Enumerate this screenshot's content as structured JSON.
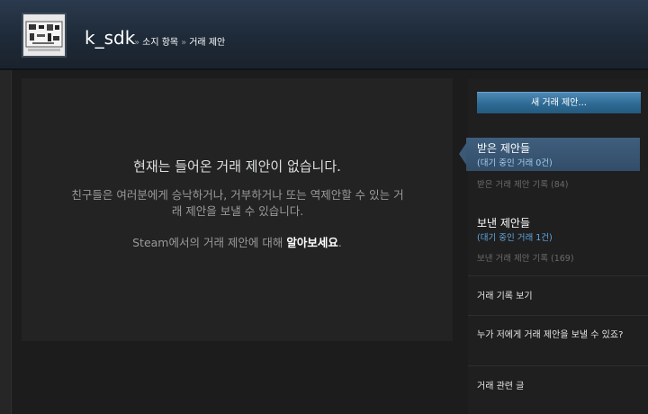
{
  "header": {
    "username": "k_sdk",
    "breadcrumb": [
      {
        "label": "소지 항목"
      },
      {
        "label": "거래 제안"
      }
    ],
    "breadcrumb_separator": "»"
  },
  "main": {
    "empty_title": "현재는 들어온 거래 제안이 없습니다.",
    "empty_description": "친구들은 여러분에게 승낙하거나, 거부하거나 또는 역제안할 수 있는 거래 제안을 보낼 수 있습니다.",
    "learn_prefix": "Steam에서의 거래 제안에 대해 ",
    "learn_link": "알아보세요",
    "learn_suffix": "."
  },
  "sidebar": {
    "new_offer_button": "새 거래 제안...",
    "received": {
      "title": "받은 제안들",
      "pending": "(대기 중인 거래 0건)",
      "history": "받은 거래 제안 기록 (84)"
    },
    "sent": {
      "title": "보낸 제안들",
      "pending": "(대기 중인 거래 1건)",
      "history": "보낸 거래 제안 기록 (169)"
    },
    "links": {
      "trade_history": "거래 기록 보기",
      "who_can_send": "누가 저에게 거래 제안을 보낼 수 있죠?",
      "trade_faq": "거래 관련 글"
    }
  },
  "colors": {
    "accent_blue": "#62a7e3",
    "button_blue": "#2d6a93",
    "active_tab": "#3f5f7e"
  }
}
